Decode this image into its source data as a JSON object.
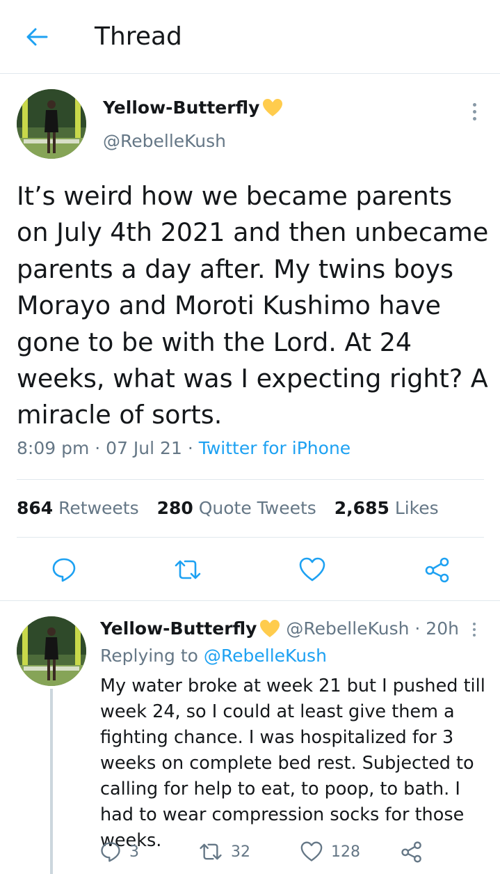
{
  "header": {
    "title": "Thread",
    "back_icon": "arrow-left-icon"
  },
  "colors": {
    "accent": "#1da1f2",
    "secondary_text": "#657786",
    "heart_emoji": "#ffcc4d"
  },
  "tweet": {
    "author_name": "Yellow-Butterfly",
    "author_emoji": "yellow-heart",
    "handle": "@RebelleKush",
    "text": "It’s weird how we became parents on July 4th 2021 and then unbecame parents a day after. My twins boys Morayo and Moroti Kushimo have gone to be with the Lord. At 24 weeks, what was I expecting right? A miracle of sorts.",
    "time": "8:09 pm",
    "date": "07 Jul 21",
    "source": "Twitter for iPhone",
    "stats": {
      "retweets": "864",
      "retweets_label": "Retweets",
      "quotes": "280",
      "quotes_label": "Quote Tweets",
      "likes": "2,685",
      "likes_label": "Likes"
    }
  },
  "reply": {
    "author_name": "Yellow-Butterfly",
    "handle": "@RebelleKush",
    "age": "20h",
    "replying_label": "Replying to",
    "replying_to": "@RebelleKush",
    "text": "My water broke at week 21 but I pushed till week 24, so I could at least give them a fighting chance. I was hospitalized for 3 weeks on complete bed rest. Subjected to calling for help to eat, to poop, to bath. I had to wear compression socks for those weeks.",
    "counts": {
      "replies": "3",
      "retweets": "32",
      "likes": "128"
    }
  },
  "sep": {
    "dot": "·"
  }
}
